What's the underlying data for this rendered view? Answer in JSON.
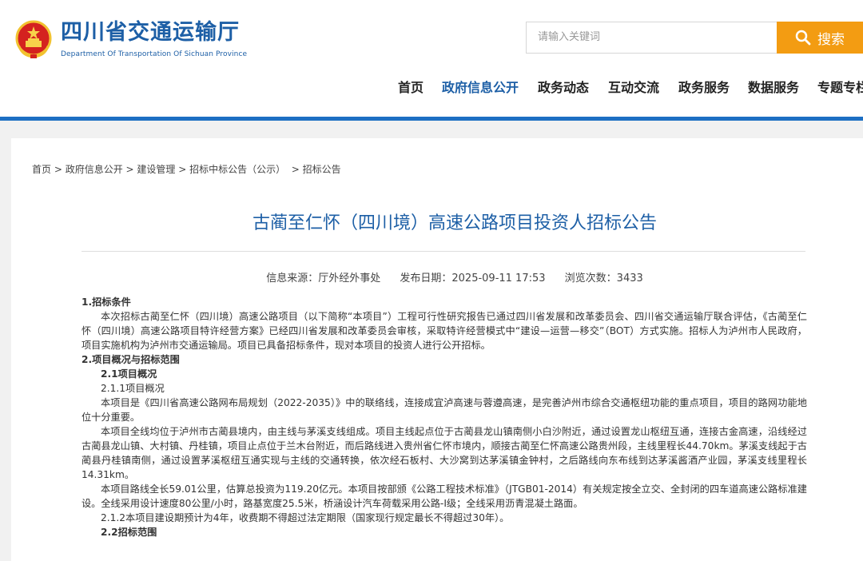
{
  "header": {
    "logo_cn": "四川省交通运输厅",
    "logo_en": "Department Of Transportation Of Sichuan Province",
    "search_placeholder": "请输入关键词",
    "search_button": "搜索",
    "nav": [
      "首页",
      "政府信息公开",
      "政务动态",
      "互动交流",
      "政务服务",
      "数据服务",
      "专题专栏"
    ],
    "active_nav": "政府信息公开",
    "colors": {
      "brand": "#1d5fa6",
      "accent": "#f39c12",
      "bar": "#1d6fc3"
    }
  },
  "breadcrumb": [
    "首页",
    "政府信息公开",
    "建设管理",
    "招标中标公告（公示）",
    "招标公告"
  ],
  "article": {
    "title": "古蔺至仁怀（四川境）高速公路项目投资人招标公告",
    "source": "信息来源：厅外经外事处",
    "date": "发布日期：2025-09-11 17:53",
    "views": "浏览次数：3433",
    "paragraphs": [
      "1.招标条件",
      "本次招标古蔺至仁怀（四川境）高速公路项目（以下简称“本项目”）工程可行性研究报告已通过四川省发展和改革委员会、四川省交通运输厅联合评估，《古蔺至仁怀（四川境）高速公路项目特许经营方案》已经四川省发展和改革委员会审核，采取特许经营模式中“建设—运营—移交”（BOT）方式实施。招标人为泸州市人民政府，项目实施机构为泸州市交通运输局。项目已具备招标条件，现对本项目的投资人进行公开招标。",
      "2.项目概况与招标范围",
      "2.1项目概况",
      "2.1.1项目概况",
      "本项目是《四川省高速公路网布局规划（2022-2035）》中的联络线，连接成宜泸高速与蓉遵高速，是完善泸州市综合交通枢纽功能的重点项目，项目的路网功能地位十分重要。",
      "本项目全线均位于泸州市古蔺县境内，由主线与茅溪支线组成。项目主线起点位于古蔺县龙山镇南侧小白沙附近，通过设置龙山枢纽互通，连接古金高速，沿线经过古蔺县龙山镇、大村镇、丹桂镇，项目止点位于兰木台附近，而后路线进入贵州省仁怀市境内，顺接古蔺至仁怀高速公路贵州段，主线里程长44.70km。茅溪支线起于古蔺县丹桂镇南侧，通过设置茅溪枢纽互通实现与主线的交通转换，依次经石板村、大沙窝到达茅溪镇金钟村，之后路线向东布线到达茅溪酱酒产业园，茅溪支线里程长14.31km。",
      "本项目路线全长59.01公里，估算总投资为119.20亿元。本项目按部颁《公路工程技术标准》（JTGB01-2014）有关规定按全立交、全封闭的四车道高速公路标准建设。全线采用设计速度80公里/小时，路基宽度25.5米，桥涵设计汽车荷载采用公路-I级；全线采用沥青混凝土路面。",
      "2.1.2本项目建设期预计为4年，收费期不得超过法定期限（国家现行规定最长不得超过30年）。",
      "2.2招标范围"
    ]
  }
}
